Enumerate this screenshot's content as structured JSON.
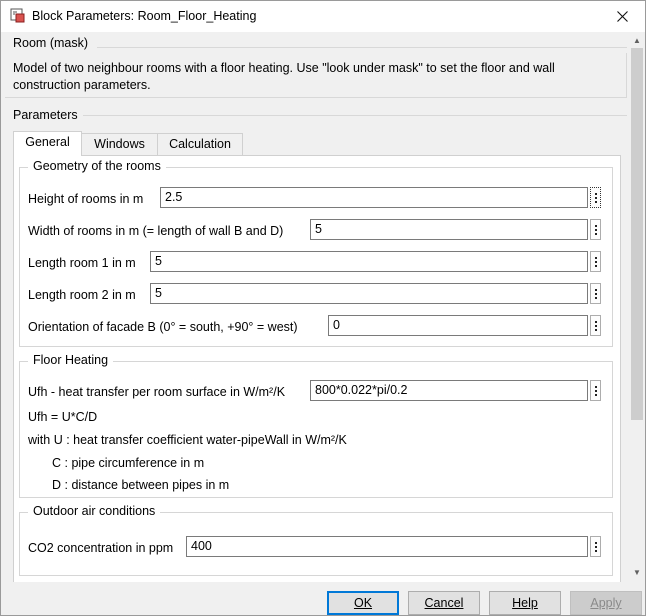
{
  "window": {
    "title": "Block Parameters: Room_Floor_Heating",
    "close_icon": "close-icon",
    "app_icon": "simulink-block-icon"
  },
  "mask": {
    "title": "Room (mask)",
    "description": "Model of two neighbour rooms with a floor heating.  Use \"look under mask\" to set the floor and wall construction parameters."
  },
  "parameters": {
    "title": "Parameters",
    "tabs": [
      {
        "label": "General",
        "active": true
      },
      {
        "label": "Windows",
        "active": false
      },
      {
        "label": "Calculation",
        "active": false
      }
    ]
  },
  "geometry": {
    "title": "Geometry of the rooms",
    "fields": [
      {
        "label": "Height of rooms in m",
        "value": "2.5"
      },
      {
        "label": "Width of rooms in m (= length of wall B and D)",
        "value": "5"
      },
      {
        "label": "Length room 1 in m",
        "value": "5"
      },
      {
        "label": "Length room 2 in m",
        "value": "5"
      },
      {
        "label": "Orientation of facade B (0° = south, +90° = west)",
        "value": "0"
      }
    ]
  },
  "floor_heating": {
    "title": "Floor Heating",
    "ufh_label": "Ufh - heat transfer per room surface in W/m²/K",
    "ufh_value": "800*0.022*pi/0.2",
    "notes": [
      "Ufh = U*C/D",
      "with U : heat transfer coefficient water-pipeWall in W/m²/K",
      "C : pipe circumference in m",
      "D : distance between pipes in m"
    ]
  },
  "outdoor": {
    "title": "Outdoor air conditions",
    "co2_label": "CO2 concentration in ppm",
    "co2_value": "400"
  },
  "buttons": {
    "ok": "OK",
    "cancel": "Cancel",
    "help": "Help",
    "apply": "Apply"
  }
}
